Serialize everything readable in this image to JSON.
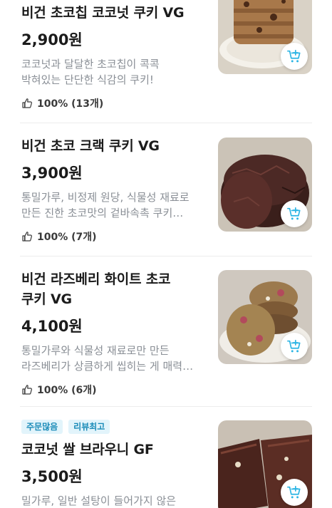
{
  "products": [
    {
      "name": "비건 초코칩 코코넛 쿠키 VG",
      "price": "2,900원",
      "description": "코코넛과 달달한 초코칩이 콕콕\n박혀있는 단단한 식감의 쿠키!",
      "rating": "100% (13개)",
      "badges": []
    },
    {
      "name": "비건 초코 크랙 쿠키 VG",
      "price": "3,900원",
      "description": "통밀가루, 비정제 원당, 식물성 재료로\n만든 진한 초코맛의 겉바속촉 쿠키…",
      "rating": "100% (7개)",
      "badges": []
    },
    {
      "name": "비건 라즈베리 화이트 초코\n쿠키 VG",
      "price": "4,100원",
      "description": "통밀가루와 식물성 재료로만 만든\n라즈베리가 상큼하게 씹히는 게 매력…",
      "rating": "100% (6개)",
      "badges": []
    },
    {
      "name": "코코넛 쌀 브라우니 GF",
      "price": "3,500원",
      "description": "밀가루, 일반 설탕이 들어가지 않은",
      "rating": "",
      "badges": [
        "주문많음",
        "리뷰최고"
      ]
    }
  ],
  "icons": {
    "cart": "cart-add-icon",
    "thumb": "thumbs-up-icon"
  },
  "colors": {
    "accent": "#2ab4e4",
    "badge_bg": "#e2f4fb",
    "badge_text": "#1a8bb8",
    "desc_text": "#8a8f96"
  }
}
